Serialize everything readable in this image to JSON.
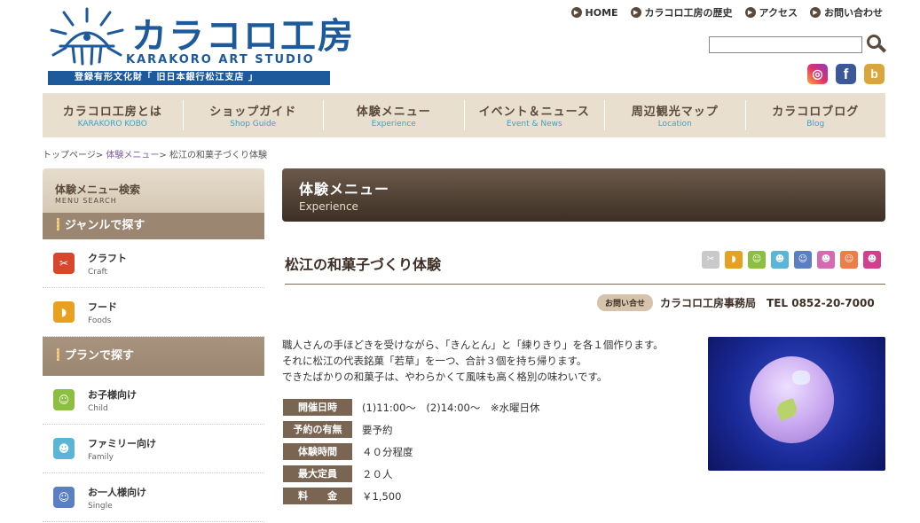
{
  "logo": {
    "name_jp": "カラコロ工房",
    "name_en": "KARAKORO ART STUDIO",
    "tagline": "登録有形文化財「 旧日本銀行松江支店 」"
  },
  "topnav": [
    {
      "label": "HOME"
    },
    {
      "label": "カラコロ工房の歴史"
    },
    {
      "label": "アクセス"
    },
    {
      "label": "お問い合わせ"
    }
  ],
  "search": {
    "value": "",
    "placeholder": ""
  },
  "social": [
    "instagram-icon",
    "facebook-icon",
    "blog-icon"
  ],
  "mainnav": [
    {
      "jp": "カラコロ工房とは",
      "en": "KARAKORO KOBO"
    },
    {
      "jp": "ショップガイド",
      "en": "Shop Guide"
    },
    {
      "jp": "体験メニュー",
      "en": "Experience"
    },
    {
      "jp": "イベント＆ニュース",
      "en": "Event & News"
    },
    {
      "jp": "周辺観光マップ",
      "en": "Location"
    },
    {
      "jp": "カラコロブログ",
      "en": "Blog"
    }
  ],
  "breadcrumb": {
    "home": "トップページ",
    "sep": ">",
    "menu": "体験メニュー",
    "current": "松江の和菓子づくり体験"
  },
  "sidebar": {
    "title_jp": "体験メニュー検索",
    "title_en": "MENU SEARCH",
    "genre_heading": "ジャンルで探す",
    "genre_items": [
      {
        "jp": "クラフト",
        "en": "Craft",
        "color": "#d9462e"
      },
      {
        "jp": "フード",
        "en": "Foods",
        "color": "#e8a021"
      }
    ],
    "plan_heading": "プランで探す",
    "plan_items": [
      {
        "jp": "お子様向け",
        "en": "Child",
        "color": "#8cbf3f"
      },
      {
        "jp": "ファミリー向け",
        "en": "Family",
        "color": "#5bb5d6"
      },
      {
        "jp": "お一人様向け",
        "en": "Single",
        "color": "#5b7fc4"
      }
    ]
  },
  "content": {
    "heading_jp": "体験メニュー",
    "heading_en": "Experience",
    "title": "松江の和菓子づくり体験",
    "category_icons": [
      {
        "name": "craft-category-icon",
        "color": "#c9c9c9"
      },
      {
        "name": "food-category-icon",
        "color": "#e8a021"
      },
      {
        "name": "child-category-icon",
        "color": "#8cbf3f"
      },
      {
        "name": "family-category-icon",
        "color": "#5bb5d6"
      },
      {
        "name": "single-category-icon",
        "color": "#5b7fc4"
      },
      {
        "name": "group-category-icon",
        "color": "#d46ab0"
      },
      {
        "name": "couple-category-icon",
        "color": "#ef7d4a"
      },
      {
        "name": "friends-category-icon",
        "color": "#d43f8d"
      }
    ],
    "contact_badge": "お問い合せ",
    "contact_text": "カラコロ工房事務局　TEL 0852-20-7000",
    "description": [
      "職人さんの手ほどきを受けながら、「きんとん」と「練りきり」を各１個作ります。",
      "それに松江の代表銘菓「若草」を一つ、合計３個を持ち帰ります。",
      "できたばかりの和菓子は、やわらかくて風味も高く格別の味わいです。"
    ],
    "info": [
      {
        "label": "開催日時",
        "value": "(1)11:00～　(2)14:00～　※水曜日休"
      },
      {
        "label": "予約の有無",
        "value": "要予約"
      },
      {
        "label": "体験時間",
        "value": "４０分程度"
      },
      {
        "label": "最大定員",
        "value": "２０人"
      },
      {
        "label": "料　　金",
        "value": "￥1,500"
      }
    ]
  }
}
